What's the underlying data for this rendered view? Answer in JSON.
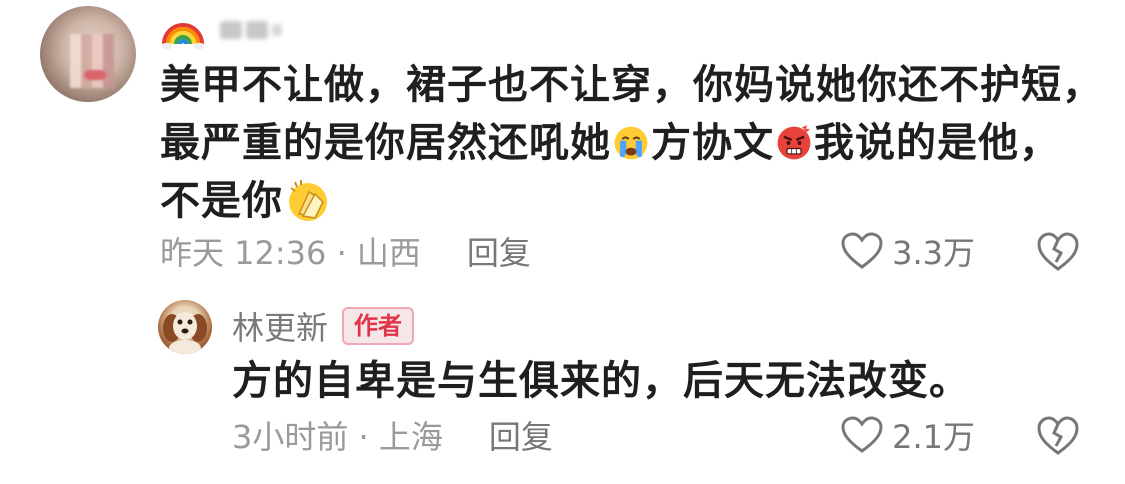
{
  "comment": {
    "text_lines": [
      [
        "美甲不让做，裙子也不让穿，你妈说她你还不护短，"
      ],
      [
        "最严重的是你居然还吼她",
        "方协文",
        "我说的是他，"
      ],
      [
        "不是你"
      ]
    ],
    "time_location": "昨天 12:36 · 山西",
    "reply_label": "回复",
    "likes": "3.3万"
  },
  "reply": {
    "username": "林更新",
    "badge": "作者",
    "text": "方的自卑是与生俱来的，后天无法改变。",
    "time_location": "3小时前 · 上海",
    "reply_label": "回复",
    "likes": "2.1万"
  },
  "icons": {
    "rainbow": "rainbow-icon",
    "crying": "crying-face-icon",
    "angry": "angry-face-icon",
    "clap": "clapping-hands-icon",
    "like": "heart-outline-icon",
    "dislike": "broken-heart-icon"
  },
  "colors": {
    "badge_red": "#e0344a",
    "meta_gray": "#9a9a9a",
    "text_dark": "#1f1f1f"
  }
}
